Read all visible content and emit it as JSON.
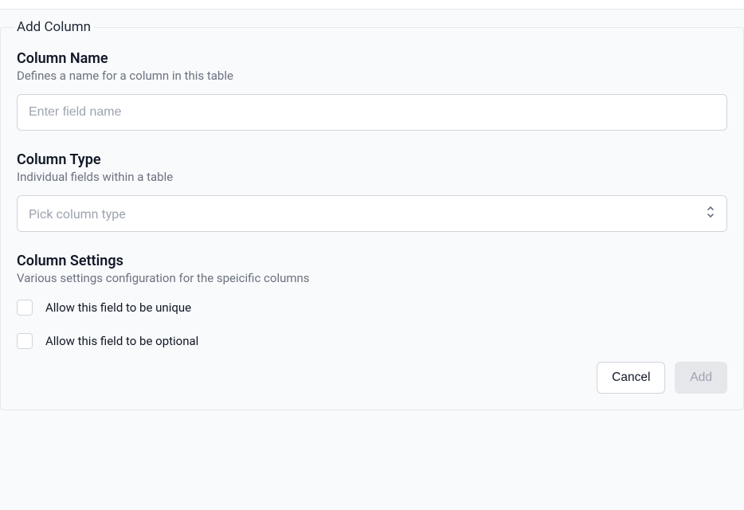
{
  "form": {
    "legend": "Add Column",
    "columnName": {
      "title": "Column Name",
      "description": "Defines a name for a column in this table",
      "placeholder": "Enter field name",
      "value": ""
    },
    "columnType": {
      "title": "Column Type",
      "description": "Individual fields within a table",
      "placeholder": "Pick column type"
    },
    "columnSettings": {
      "title": "Column Settings",
      "description": "Various settings configuration for the speicific columns",
      "uniqueLabel": "Allow this field to be unique",
      "optionalLabel": "Allow this field to be optional"
    },
    "buttons": {
      "cancel": "Cancel",
      "add": "Add"
    }
  }
}
